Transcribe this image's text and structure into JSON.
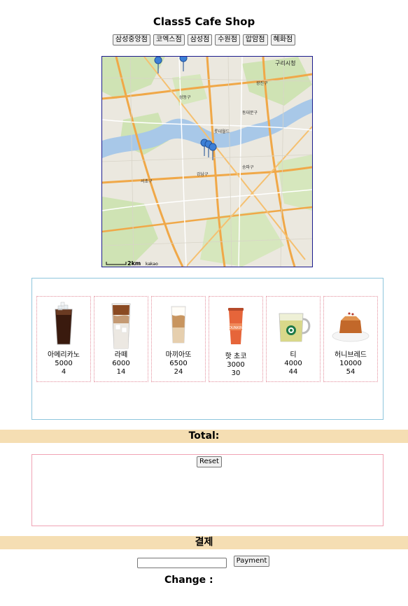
{
  "title": "Class5 Cafe Shop",
  "branches": [
    "삼성중앙점",
    "코엑스점",
    "삼성점",
    "수원점",
    "압암점",
    "혜화점"
  ],
  "map": {
    "labels": [
      "구리시청",
      "2km",
      "kakao",
      "롯데월드",
      "잠실",
      "송파구",
      "강남구",
      "서초구",
      "성동구",
      "광진구",
      "동대문구"
    ]
  },
  "menu": [
    {
      "name": "아메리카노",
      "price": "5000",
      "count": "4",
      "icon": "iced-americano-icon"
    },
    {
      "name": "라떼",
      "price": "6000",
      "count": "14",
      "icon": "iced-latte-icon"
    },
    {
      "name": "마끼아또",
      "price": "6500",
      "count": "24",
      "icon": "macchiato-icon"
    },
    {
      "name": "핫 초코",
      "price": "3000",
      "count": "30",
      "icon": "hot-chocolate-icon"
    },
    {
      "name": "티",
      "price": "4000",
      "count": "44",
      "icon": "tea-icon"
    },
    {
      "name": "허니브레드",
      "price": "10000",
      "count": "54",
      "icon": "honey-bread-icon"
    }
  ],
  "total_label": "Total:",
  "reset_label": "Reset",
  "payment_heading": "결제",
  "payment_input_value": "",
  "payment_button": "Payment",
  "change_label": "Change :",
  "colors": {
    "accent_bar": "#f5deb3",
    "menu_border": "#8ec6dc",
    "cart_border": "#f0a3b4",
    "item_border": "#e38c9a"
  }
}
